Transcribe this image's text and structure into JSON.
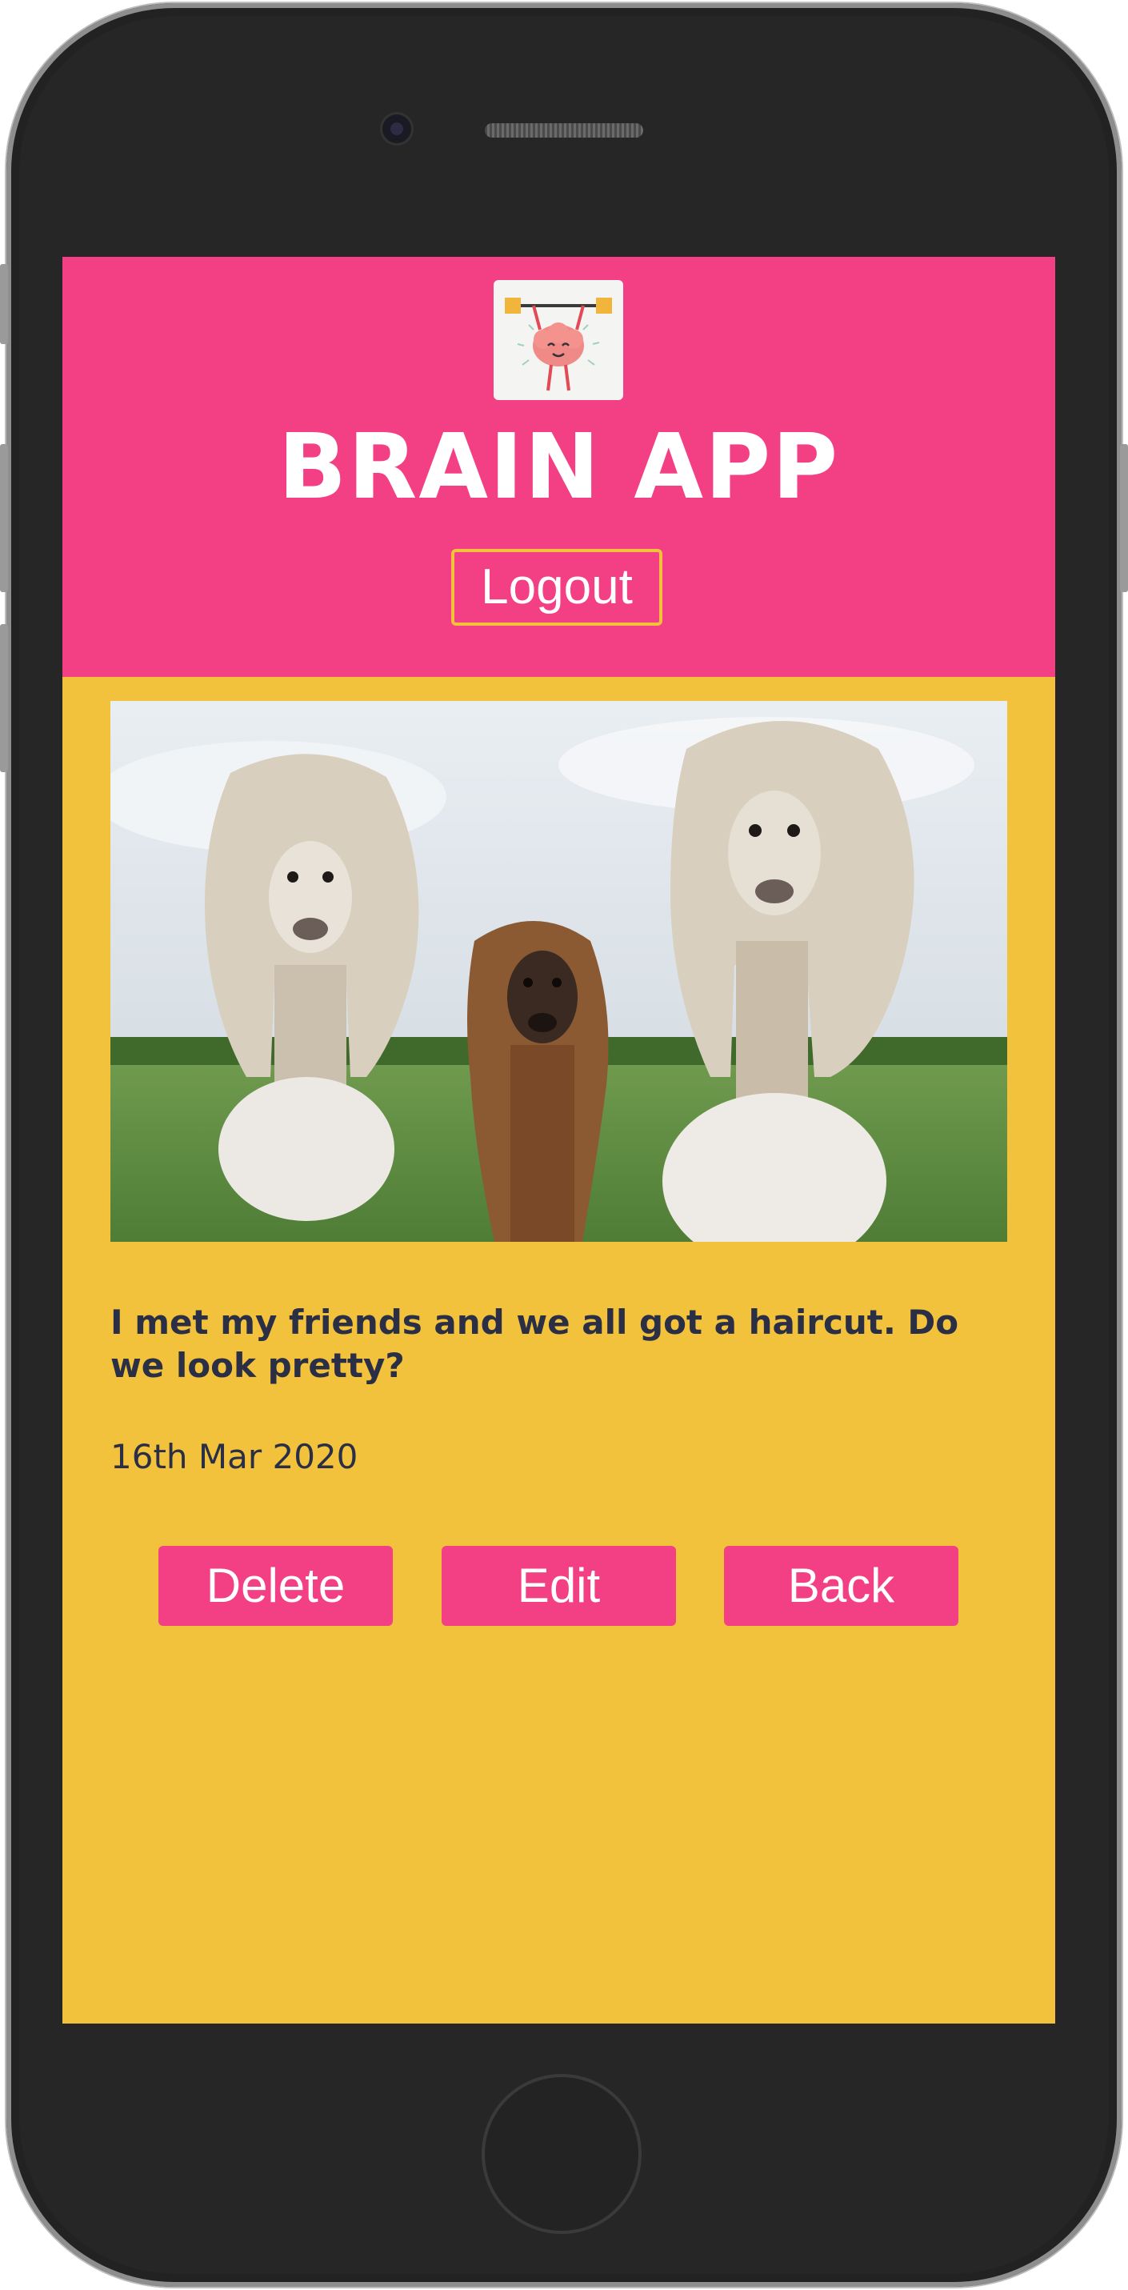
{
  "app": {
    "title": "BRAIN APP",
    "logout_label": "Logout"
  },
  "post": {
    "caption": "I met my friends and we all got a haircut. Do we look pretty?",
    "date": "16th Mar 2020",
    "image_subject": "three-alpacas-with-haircuts"
  },
  "actions": {
    "delete_label": "Delete",
    "edit_label": "Edit",
    "back_label": "Back"
  },
  "colors": {
    "header": "#f33f83",
    "background": "#f2c23c",
    "text": "#2a2f45",
    "button": "#f33f83"
  }
}
